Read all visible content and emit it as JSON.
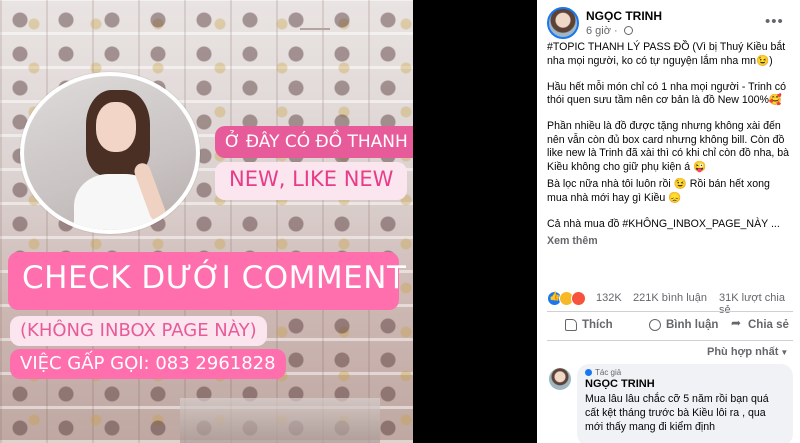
{
  "image": {
    "tag_1": "Ở ĐÂY CÓ ĐỒ THANH LÝ",
    "tag_2": "NEW, LIKE NEW",
    "tag_3": "CHECK DƯỚI COMMENT",
    "tag_3_emoji": "👇",
    "tag_4": "(KHÔNG INBOX PAGE NÀY)",
    "tag_5": "VIỆC GẤP GỌI:  083 2961828"
  },
  "post": {
    "author": "NGỌC TRINH",
    "time": "6 giờ",
    "more": "•••",
    "paragraphs": [
      "#TOPIC THANH LÝ PASS ĐỒ (Vì bị Thuý Kiều bắt nha mọi người, ko có tự nguyện lắm nha mn😉)",
      "Hầu hết mỗi món chỉ có 1 nha mọi người - Trinh có thói quen sưu tầm nên cơ bản là đồ New 100%🥰",
      "Phần nhiều là đồ được tặng nhưng không xài đến nên vẫn còn đủ box card nhưng không bill. Còn đồ like new là Trinh đã xài thì có khi chỉ còn đồ nha, bà Kiều không cho giữ phụ kiện á 😜",
      "Bà lọc nữa nhà tôi luôn rồi 😉 Rồi bán hết xong mua nhà mới hay gì Kiều 😞",
      "Cả nhà mua đồ #KHÔNG_INBOX_PAGE_NÀY ..."
    ],
    "see_more": "Xem thêm",
    "reaction_count": "132K",
    "comments": "221K bình luận",
    "shares": "31K lượt chia sẻ",
    "actions": {
      "like": "Thích",
      "comment": "Bình luận",
      "share": "Chia sẻ"
    },
    "sort": "Phù hợp nhất",
    "top_comment": {
      "badge": "Tác giả",
      "name": "NGỌC TRINH",
      "text": "Mua lâu lâu chắc cỡ 5 năm rồi bạn quá cất kệt tháng trước bà Kiều lôi ra , qua mới thấy mang đi kiểm định"
    }
  }
}
